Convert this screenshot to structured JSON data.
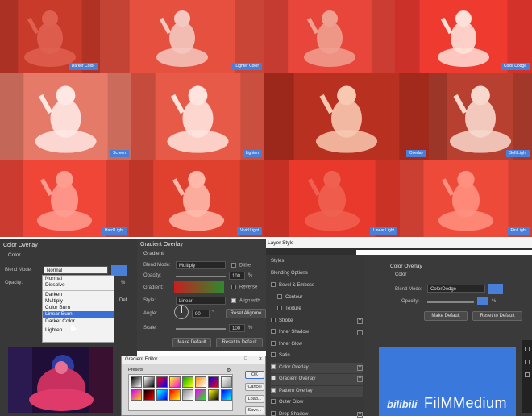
{
  "tiles": [
    {
      "label": "Darker Color",
      "bg": "#c83a2a",
      "fg": "#e06050"
    },
    {
      "label": "Lighter Color",
      "bg": "#e5503f",
      "fg": "#f4c8c0"
    },
    {
      "label": "",
      "bg": "#e8463a",
      "fg": "#f0a090"
    },
    {
      "label": "Color Dodge",
      "bg": "#ef3a30",
      "fg": "#ffe0d8"
    },
    {
      "label": "Screen",
      "bg": "#e67a68",
      "fg": "#ffe8e4"
    },
    {
      "label": "Lighten",
      "bg": "#e85a48",
      "fg": "#ffe4de"
    },
    {
      "label": "Overlay",
      "bg": "#b83020",
      "fg": "#f8c8b0"
    },
    {
      "label": "Soft Light",
      "bg": "#b84030",
      "fg": "#f8d8cc"
    },
    {
      "label": "Hard Light",
      "bg": "#ef4638",
      "fg": "#ff9c90"
    },
    {
      "label": "Vivid Light",
      "bg": "#e0402e",
      "fg": "#ffb8a8"
    },
    {
      "label": "Linear Light",
      "bg": "#e8392c",
      "fg": "#f06050"
    },
    {
      "label": "Pin Light",
      "bg": "#ee4a3a",
      "fg": "#ff9080"
    }
  ],
  "color_overlay": {
    "title": "Color Overlay",
    "subtitle": "Color",
    "blend_label": "Blend Mode:",
    "blend_value": "Normal",
    "opacity_label": "Opacity:",
    "pct": "%",
    "def_fragment": "Def",
    "swatch": "#4a7fd9",
    "options": [
      "Normal",
      "Dissolve",
      "",
      "Darken",
      "Multiply",
      "Color Burn",
      "Linear Burn",
      "Darker Color",
      "",
      "Lighten"
    ],
    "selected_index": 6
  },
  "gradient_overlay": {
    "title": "Gradient Overlay",
    "subtitle": "Gradient",
    "blend_label": "Blend Mode:",
    "blend_value": "Multiply",
    "dither": "Dither",
    "opacity_label": "Opacity:",
    "opacity_value": "100",
    "pct": "%",
    "gradient_label": "Gradient:",
    "reverse": "Reverse",
    "style_label": "Style:",
    "style_value": "Linear",
    "align": "Align with",
    "angle_label": "Angle:",
    "angle_value": "90",
    "reset_align": "Reset Alignme",
    "scale_label": "Scale:",
    "scale_value": "100",
    "make_default": "Make Default",
    "reset_default": "Reset to Default"
  },
  "gradient_editor": {
    "title": "Gradient Editor",
    "presets": "Presets",
    "ok": "OK",
    "cancel": "Cancel",
    "load": "Load...",
    "save": "Save..."
  },
  "layer_style": {
    "title": "Layer Style",
    "styles": "Styles",
    "blending_options": "Blending Options",
    "items": [
      {
        "label": "Bevel & Emboss",
        "checked": false,
        "plus": false,
        "indent": false
      },
      {
        "label": "Contour",
        "checked": false,
        "plus": false,
        "indent": true
      },
      {
        "label": "Texture",
        "checked": false,
        "plus": false,
        "indent": true
      },
      {
        "label": "Stroke",
        "checked": false,
        "plus": true,
        "indent": false
      },
      {
        "label": "Inner Shadow",
        "checked": false,
        "plus": true,
        "indent": false
      },
      {
        "label": "Inner Glow",
        "checked": false,
        "plus": false,
        "indent": false
      },
      {
        "label": "Satin",
        "checked": false,
        "plus": false,
        "indent": false
      },
      {
        "label": "Color Overlay",
        "checked": true,
        "plus": true,
        "indent": false
      },
      {
        "label": "Gradient Overlay",
        "checked": true,
        "plus": true,
        "indent": false
      },
      {
        "label": "Pattern Overlay",
        "checked": true,
        "plus": false,
        "indent": false
      },
      {
        "label": "Outer Glow",
        "checked": false,
        "plus": false,
        "indent": false
      },
      {
        "label": "Drop Shadow",
        "checked": false,
        "plus": true,
        "indent": false
      }
    ],
    "right_title": "Color Overlay",
    "right_sub": "Color",
    "blend_label": "Blend Mode:",
    "blend_value": "ColorDodge",
    "opacity_label": "Opacity:",
    "pct": "%",
    "make_default": "Make Default",
    "reset_default": "Reset to Default",
    "swatch": "#4a7fd9",
    "preview": "#3a78dc"
  },
  "watermark": "FilMMedium",
  "watermark_logo": "bilibili"
}
